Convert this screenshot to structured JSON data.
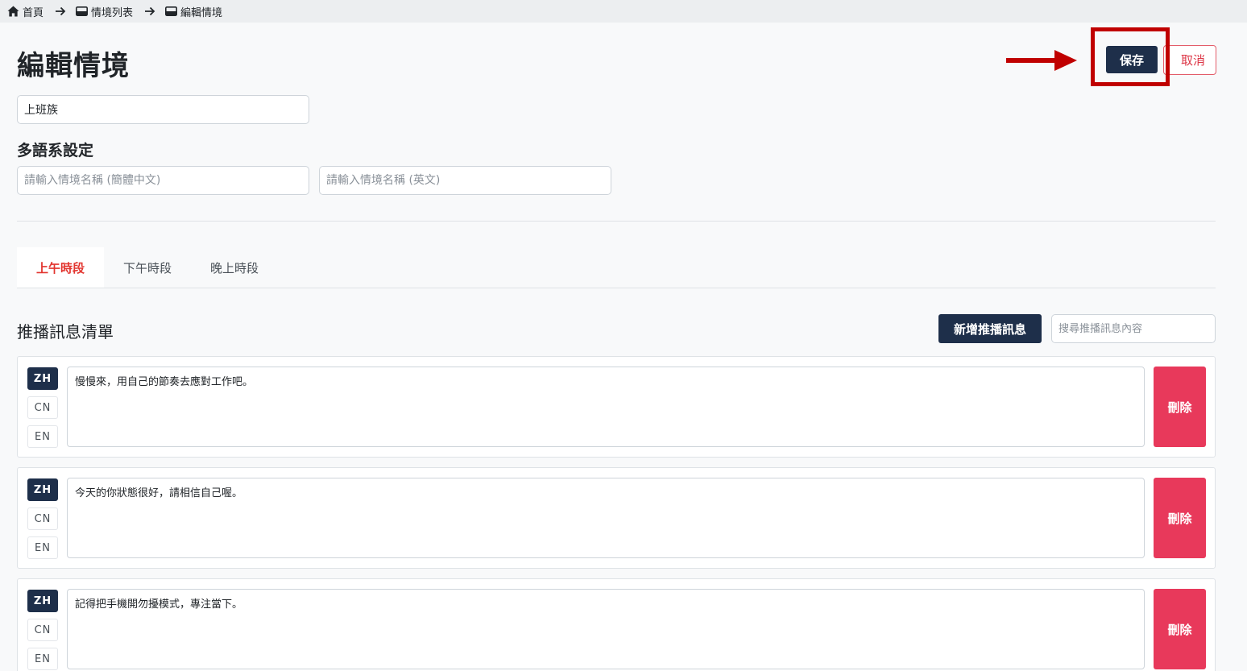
{
  "breadcrumb": {
    "home": "首頁",
    "list": "情境列表",
    "current": "編輯情境"
  },
  "page": {
    "title": "編輯情境"
  },
  "actions": {
    "save_label": "保存",
    "cancel_label": "取消"
  },
  "form": {
    "name_value": "上班族",
    "i18n_title": "多語系設定",
    "name_cn_placeholder": "請輸入情境名稱 (簡體中文)",
    "name_en_placeholder": "請輸入情境名稱 (英文)"
  },
  "tabs": [
    {
      "label": "上午時段",
      "active": true
    },
    {
      "label": "下午時段",
      "active": false
    },
    {
      "label": "晚上時段",
      "active": false
    }
  ],
  "messages": {
    "title": "推播訊息清單",
    "add_label": "新增推播訊息",
    "search_placeholder": "搜尋推播訊息內容",
    "lang_labels": [
      "ZH",
      "CN",
      "EN"
    ],
    "delete_label": "刪除",
    "items": [
      {
        "text": "慢慢來，用自己的節奏去應對工作吧。",
        "active_lang": "ZH"
      },
      {
        "text": "今天的你狀態很好，請相信自己喔。",
        "active_lang": "ZH"
      },
      {
        "text": "記得把手機開勿擾模式，專注當下。",
        "active_lang": "ZH"
      }
    ]
  },
  "colors": {
    "primary": "#1e2f4a",
    "danger": "#e8395b",
    "active_tab": "#e2352f",
    "highlight": "#c00000"
  },
  "icons": {
    "home": "home-icon",
    "separator": "arrow-right-icon",
    "list": "inbox-icon",
    "annotation": "annotation-arrow-icon"
  }
}
